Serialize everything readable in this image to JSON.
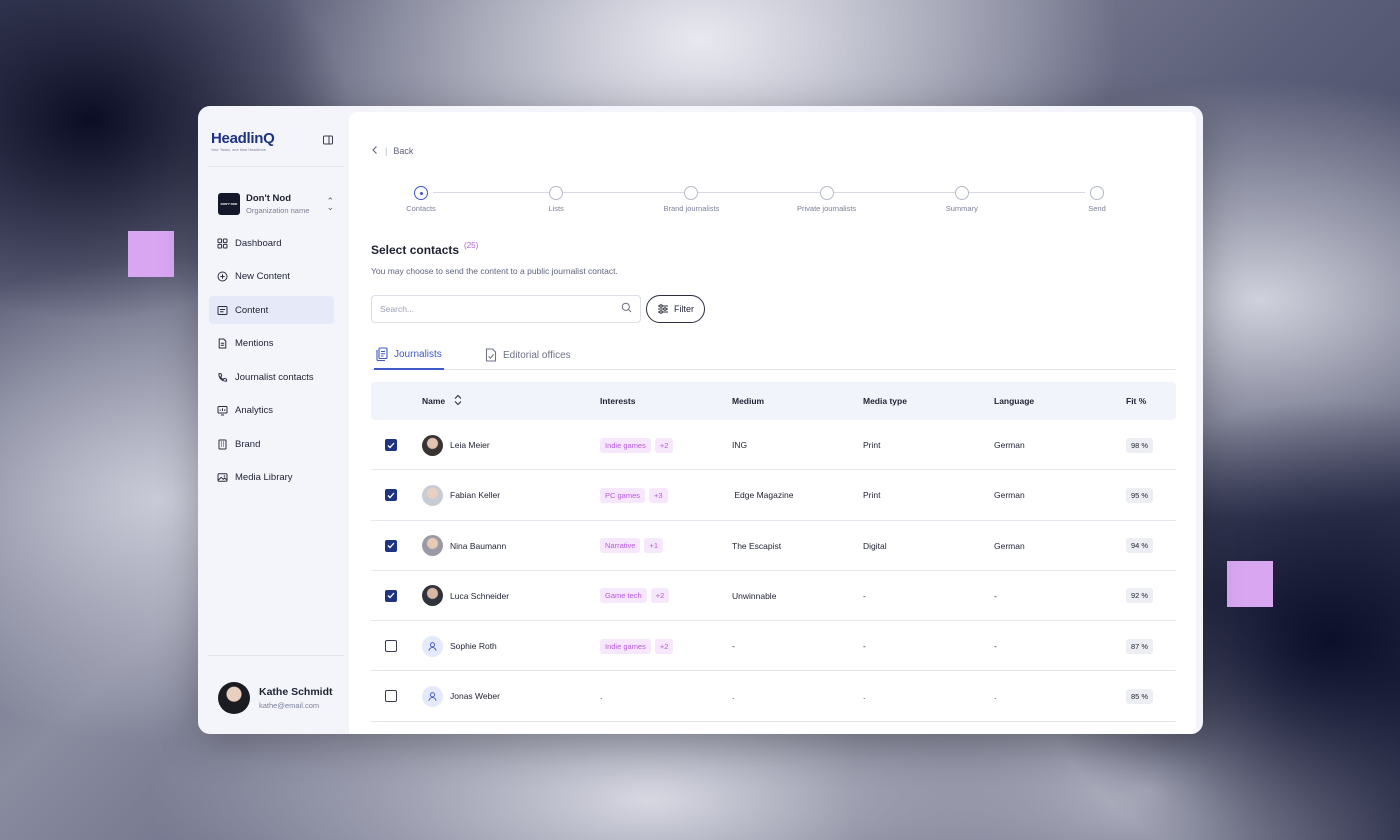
{
  "brand": {
    "name": "Headlin",
    "q": "Q",
    "tagline": "Your Tasks, one time Headlinne"
  },
  "org": {
    "name": "Don't Nod",
    "subtitle": "Organization name",
    "logo_text": "DON'T NOD"
  },
  "nav": [
    {
      "label": "Dashboard",
      "icon": "dashboard-icon",
      "active": false
    },
    {
      "label": "New Content",
      "icon": "plus-circle-icon",
      "active": false
    },
    {
      "label": "Content",
      "icon": "content-icon",
      "active": true
    },
    {
      "label": "Mentions",
      "icon": "document-icon",
      "active": false
    },
    {
      "label": "Journalist contacts",
      "icon": "phone-icon",
      "active": false
    },
    {
      "label": "Analytics",
      "icon": "analytics-icon",
      "active": false
    },
    {
      "label": "Brand",
      "icon": "building-icon",
      "active": false
    },
    {
      "label": "Media Library",
      "icon": "image-icon",
      "active": false
    }
  ],
  "user": {
    "name": "Kathe Schmidt",
    "email": "kathe@email.com"
  },
  "back_label": "Back",
  "steps": [
    "Contacts",
    "Lists",
    "Brand journalists",
    "Private journalists",
    "Summary",
    "Send"
  ],
  "current_step": 0,
  "title": "Select contacts",
  "count": "(25)",
  "subtitle": "You may choose to send the content to a public journalist contact.",
  "search": {
    "placeholder": "Search..."
  },
  "filter_label": "Filter",
  "tabs": {
    "journalists": "Journalists",
    "offices": "Editorial offices"
  },
  "columns": {
    "name": "Name",
    "interests": "Interests",
    "medium": "Medium",
    "media_type": "Media  type",
    "language": "Language",
    "fit": "Fit %"
  },
  "rows": [
    {
      "checked": true,
      "avatar": "photo",
      "name": "Leia Meier",
      "interest": "Indie games",
      "more": "+2",
      "medium": "ING",
      "media_type": "Print",
      "language": "German",
      "fit": "98 %"
    },
    {
      "checked": true,
      "avatar": "photo2",
      "name": "Fabian Keller",
      "interest": "PC games",
      "more": "+3",
      "medium": " Edge Magazine",
      "media_type": "Print",
      "language": "German",
      "fit": "95 %"
    },
    {
      "checked": true,
      "avatar": "photo3",
      "name": "Nina Baumann",
      "interest": "Narrative",
      "more": "+1",
      "medium": "The Escapist",
      "media_type": "Digital",
      "language": "German",
      "fit": "94 %"
    },
    {
      "checked": true,
      "avatar": "photo4",
      "name": "Luca Schneider",
      "interest": "Game tech",
      "more": "+2",
      "medium": "Unwinnable",
      "media_type": "-",
      "language": "-",
      "fit": "92 %"
    },
    {
      "checked": false,
      "avatar": "placeholder",
      "name": "Sophie Roth",
      "interest": "Indie games",
      "more": "+2",
      "medium": "-",
      "media_type": "-",
      "language": "-",
      "fit": "87 %"
    },
    {
      "checked": false,
      "avatar": "placeholder",
      "name": "Jonas Weber",
      "interest": "",
      "more": "",
      "interest_text": ".",
      "medium": ".",
      "media_type": ".",
      "language": ".",
      "fit": "85 %"
    }
  ],
  "colors": {
    "accent": "#3e58c8",
    "brand": "#1e3480",
    "tag_text": "#b45ad9",
    "tag_bg": "#f7e7fd",
    "deco": "#d9a6f2"
  }
}
